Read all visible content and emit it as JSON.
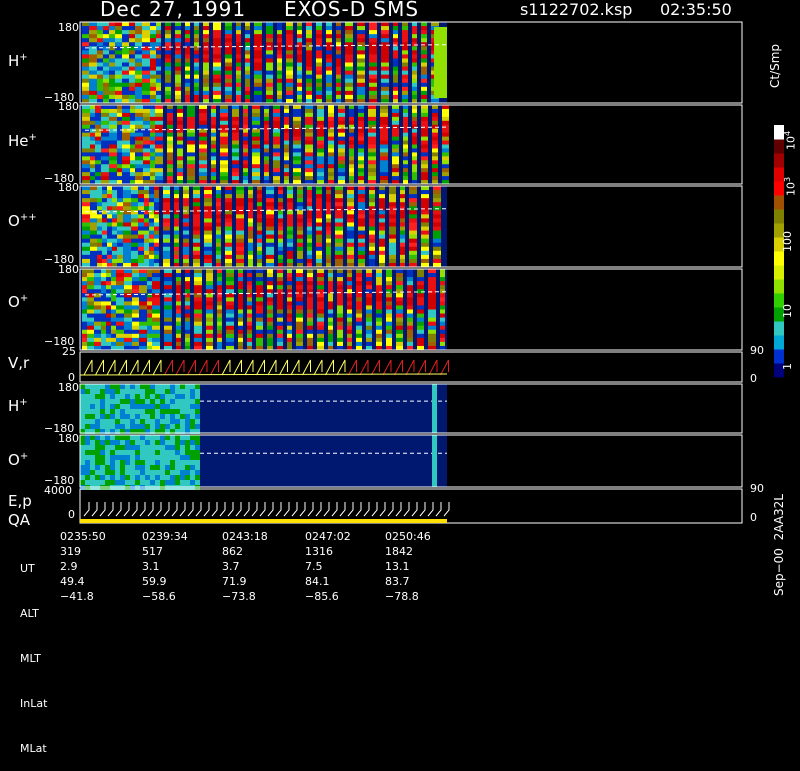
{
  "header": {
    "date": "Dec 27, 1991",
    "instrument": "EXOS-D SMS",
    "file": "s1122702.ksp",
    "time": "02:35:50"
  },
  "panels": [
    {
      "label": "H",
      "sup": "+",
      "ytop": "180",
      "ybot": "−180"
    },
    {
      "label": "He",
      "sup": "+",
      "ytop": "180",
      "ybot": "−180"
    },
    {
      "label": "O",
      "sup": "++",
      "ytop": "180",
      "ybot": "−180"
    },
    {
      "label": "O",
      "sup": "+",
      "ytop": "180",
      "ybot": "−180"
    }
  ],
  "vr_panel": {
    "label": "V,r",
    "ytop": "25",
    "ybot": "0",
    "rtop": "90",
    "rbot": "0"
  },
  "lower_panels": [
    {
      "label": "H",
      "sup": "+",
      "ytop": "180",
      "ybot": "−180"
    },
    {
      "label": "O",
      "sup": "+",
      "ytop": "180",
      "ybot": "−180"
    }
  ],
  "ep_panel": {
    "label1": "E,p",
    "label2": "QA",
    "ytop": "4000",
    "ybot": "0",
    "rtop": "90",
    "rbot": "0"
  },
  "colorbar": {
    "unit": "Ct/Smp",
    "ticks": [
      "1",
      "10",
      "100",
      "10",
      "10"
    ],
    "tick_sups": [
      "",
      "",
      "",
      "3",
      "4"
    ],
    "colors": [
      "#00007a",
      "#0030d0",
      "#00a8d8",
      "#30c8c0",
      "#00a000",
      "#30d000",
      "#90e000",
      "#d8f000",
      "#ffff00",
      "#d8d000",
      "#a0a000",
      "#808000",
      "#a05000",
      "#ff0000",
      "#e00000",
      "#a00000",
      "#600000",
      "#ffffff"
    ]
  },
  "footer_id": "Sep−00  2AA32L",
  "chart_data": {
    "type": "heatmap",
    "title": "Dec 27, 1991   EXOS-D SMS",
    "x_ticks": [
      "0235:50",
      "0239:34",
      "0243:18",
      "0247:02",
      "0250:46"
    ],
    "ephemeris": [
      {
        "name": "UT",
        "values": [
          "0235:50",
          "0239:34",
          "0243:18",
          "0247:02",
          "0250:46"
        ]
      },
      {
        "name": "ALT",
        "values": [
          "319",
          "517",
          "862",
          "1316",
          "1842"
        ]
      },
      {
        "name": "MLT",
        "values": [
          "2.9",
          "3.1",
          "3.7",
          "7.5",
          "13.1"
        ]
      },
      {
        "name": "InLat",
        "values": [
          "49.4",
          "59.9",
          "71.9",
          "84.1",
          "83.7"
        ]
      },
      {
        "name": "MLat",
        "values": [
          "−41.8",
          "−58.6",
          "−73.8",
          "−85.6",
          "−78.8"
        ]
      }
    ],
    "colorbar_scale": "log",
    "colorbar_range": [
      1,
      10000
    ]
  }
}
